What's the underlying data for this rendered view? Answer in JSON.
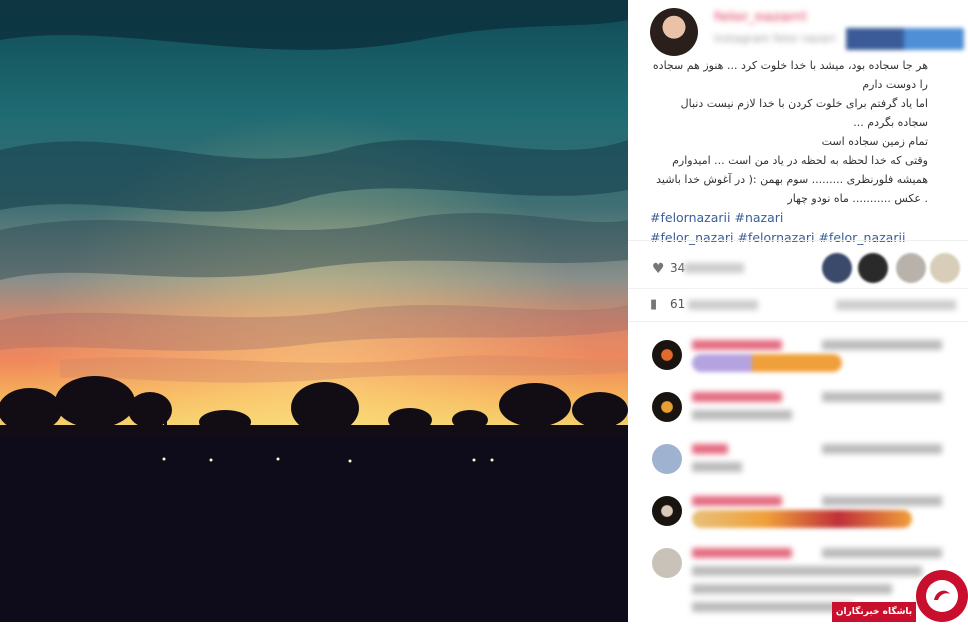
{
  "post": {
    "username": "felor_nazarri",
    "subline": "instagram felor nazari",
    "caption_lines": [
      "هر جا سجاده بود، میشد با خدا خلوت کرد ... هنوز هم سجاده را دوست دارم",
      "اما یاد گرفتم برای خلوت کردن با خدا لازم نیست دنبال سجاده بگردم ...",
      "تمام زمین سجاده است",
      "وقتی که خدا لحظه به لحظه در یاد من است ... امیدوارم همیشه فلورنظری ......... سوم بهمن :( در آغوش خدا باشید . عکس ........... ماه نودو چهار"
    ],
    "caption_hashtags_line1": "#felornazarii #nazari",
    "caption_hashtags_line2": "#felor_nazari #felornazari #felor_nazarii",
    "likes_count": "34",
    "comments_count": "61"
  },
  "icons": {
    "likes": "heart-icon",
    "comments": "comment-bubble-icon"
  },
  "watermark": {
    "label": "باشگاه خبرنگاران"
  },
  "colors": {
    "hashtag": "#3a5e96",
    "username": "#e87a8e",
    "watermark_red": "#c8102e"
  }
}
